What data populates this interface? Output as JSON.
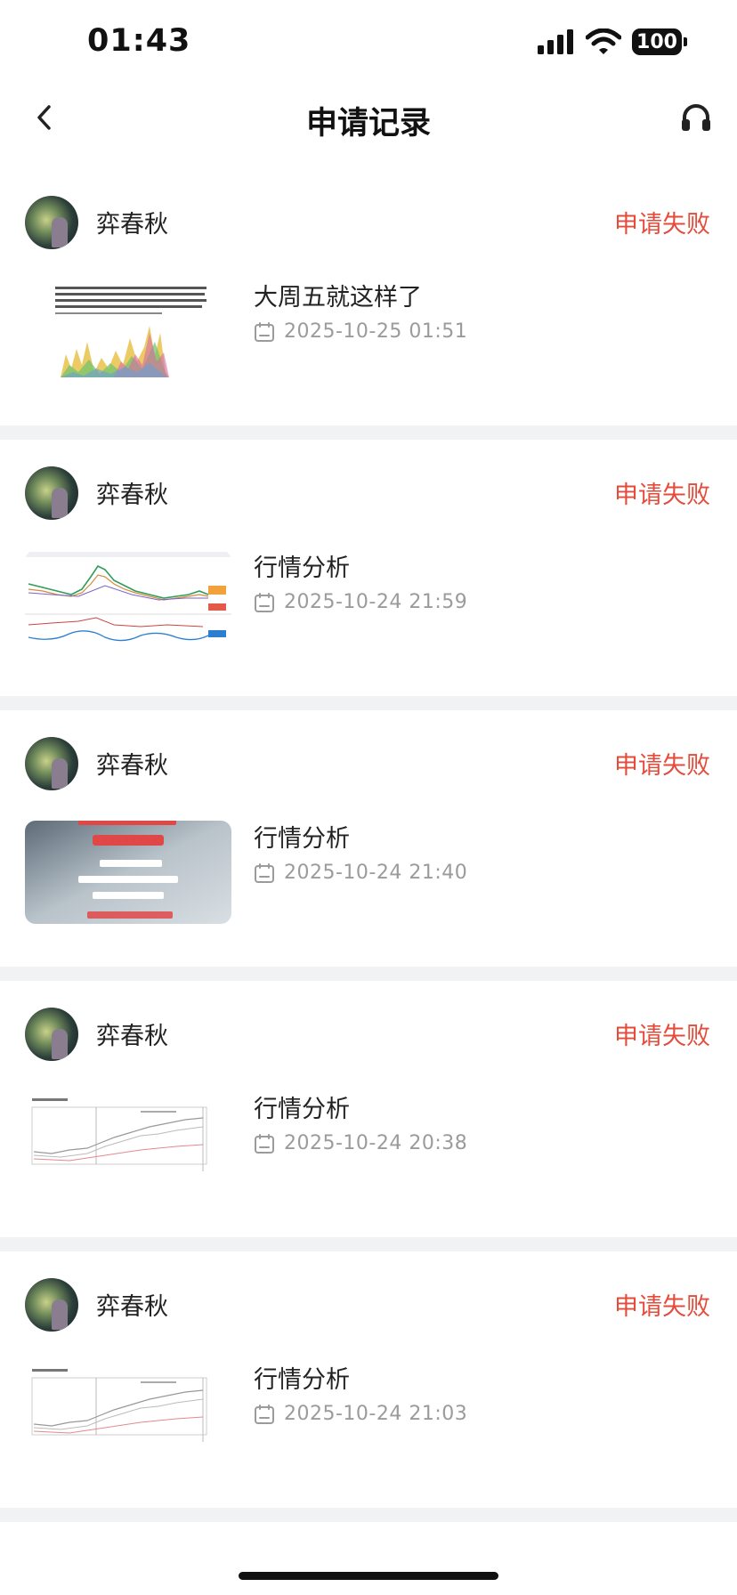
{
  "status_bar": {
    "time": "01:43",
    "battery": "100"
  },
  "nav": {
    "title": "申请记录",
    "back_icon": "chevron-left-icon",
    "support_icon": "headset-icon"
  },
  "colors": {
    "fail": "#e34b3b",
    "divider": "#f1f2f4",
    "date": "#9b9b9b"
  },
  "records": [
    {
      "user": "弈春秋",
      "status": "申请失败",
      "title": "大周五就这样了",
      "date": "2025-10-25 01:51",
      "thumb_type": "text-chart"
    },
    {
      "user": "弈春秋",
      "status": "申请失败",
      "title": "行情分析",
      "date": "2025-10-24 21:59",
      "thumb_type": "kline"
    },
    {
      "user": "弈春秋",
      "status": "申请失败",
      "title": "行情分析",
      "date": "2025-10-24 21:40",
      "thumb_type": "poster"
    },
    {
      "user": "弈春秋",
      "status": "申请失败",
      "title": "行情分析",
      "date": "2025-10-24 20:38",
      "thumb_type": "line-chart"
    },
    {
      "user": "弈春秋",
      "status": "申请失败",
      "title": "行情分析",
      "date": "2025-10-24 21:03",
      "thumb_type": "line-chart"
    }
  ]
}
